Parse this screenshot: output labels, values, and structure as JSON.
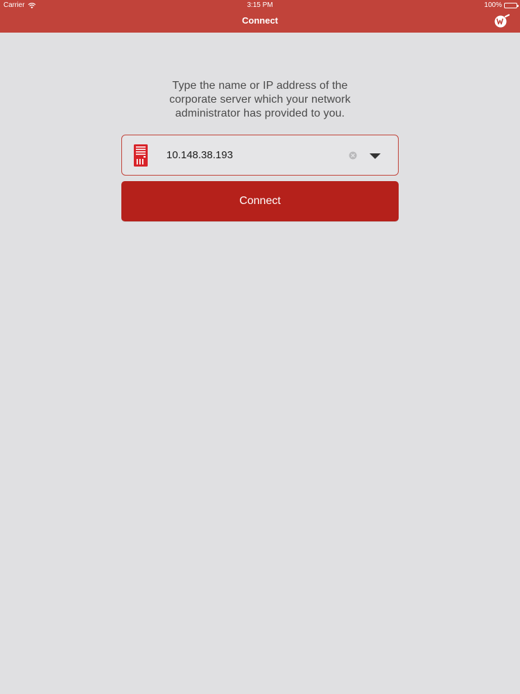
{
  "status_bar": {
    "carrier": "Carrier",
    "time": "3:15 PM",
    "battery": "100%"
  },
  "nav": {
    "title": "Connect",
    "logo_icon": "watchguard-logo-icon"
  },
  "main": {
    "instruction": "Type the name or IP address of the\ncorporate server which your network\nadministrator has provided to you.",
    "server_field": {
      "value": "10.148.38.193",
      "icon": "server-icon",
      "clear_icon": "clear-icon",
      "dropdown_icon": "chevron-down-icon"
    },
    "connect_button_label": "Connect"
  },
  "colors": {
    "brand_red": "#c1433a",
    "button_red": "#b5211b",
    "background": "#e0e0e2",
    "text": "#4a4a4a"
  }
}
